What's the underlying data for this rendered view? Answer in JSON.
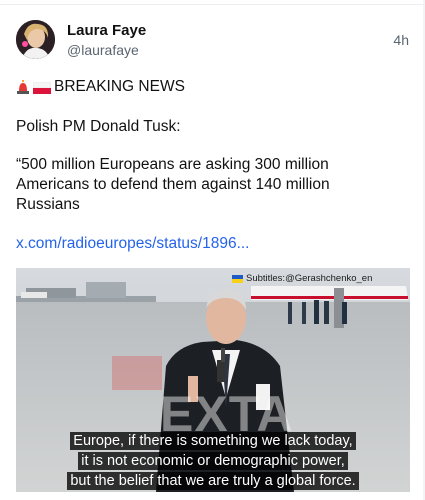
{
  "tweet": {
    "author": {
      "name": "Laura Faye",
      "handle": "@laurafaye",
      "avatar": "profile-photo"
    },
    "timestamp": "4h",
    "body": {
      "headline_icons": [
        "police-light-emoji",
        "poland-flag-emoji"
      ],
      "headline": "BREAKING NEWS",
      "speaker_line": "Polish PM Donald Tusk:",
      "quote_lines": [
        "“500 million Europeans are asking 300 million",
        "Americans to defend them against 140 million",
        "Russians"
      ],
      "link": "x.com/radioeuropes/status/1896..."
    },
    "media": {
      "type": "video-still",
      "credit_icon": "ukraine-flag-emoji",
      "credit": "Subtitles:@Gerashchenko_en",
      "watermark": "EXTA",
      "subtitle_lines": [
        "Europe, if there is something we lack today,",
        "it is not economic or demographic power,",
        "but the belief that we are truly a global force."
      ]
    }
  },
  "colors": {
    "link": "#2563eb",
    "secondary_text": "#5b6570",
    "caption_bg": "#000000"
  }
}
